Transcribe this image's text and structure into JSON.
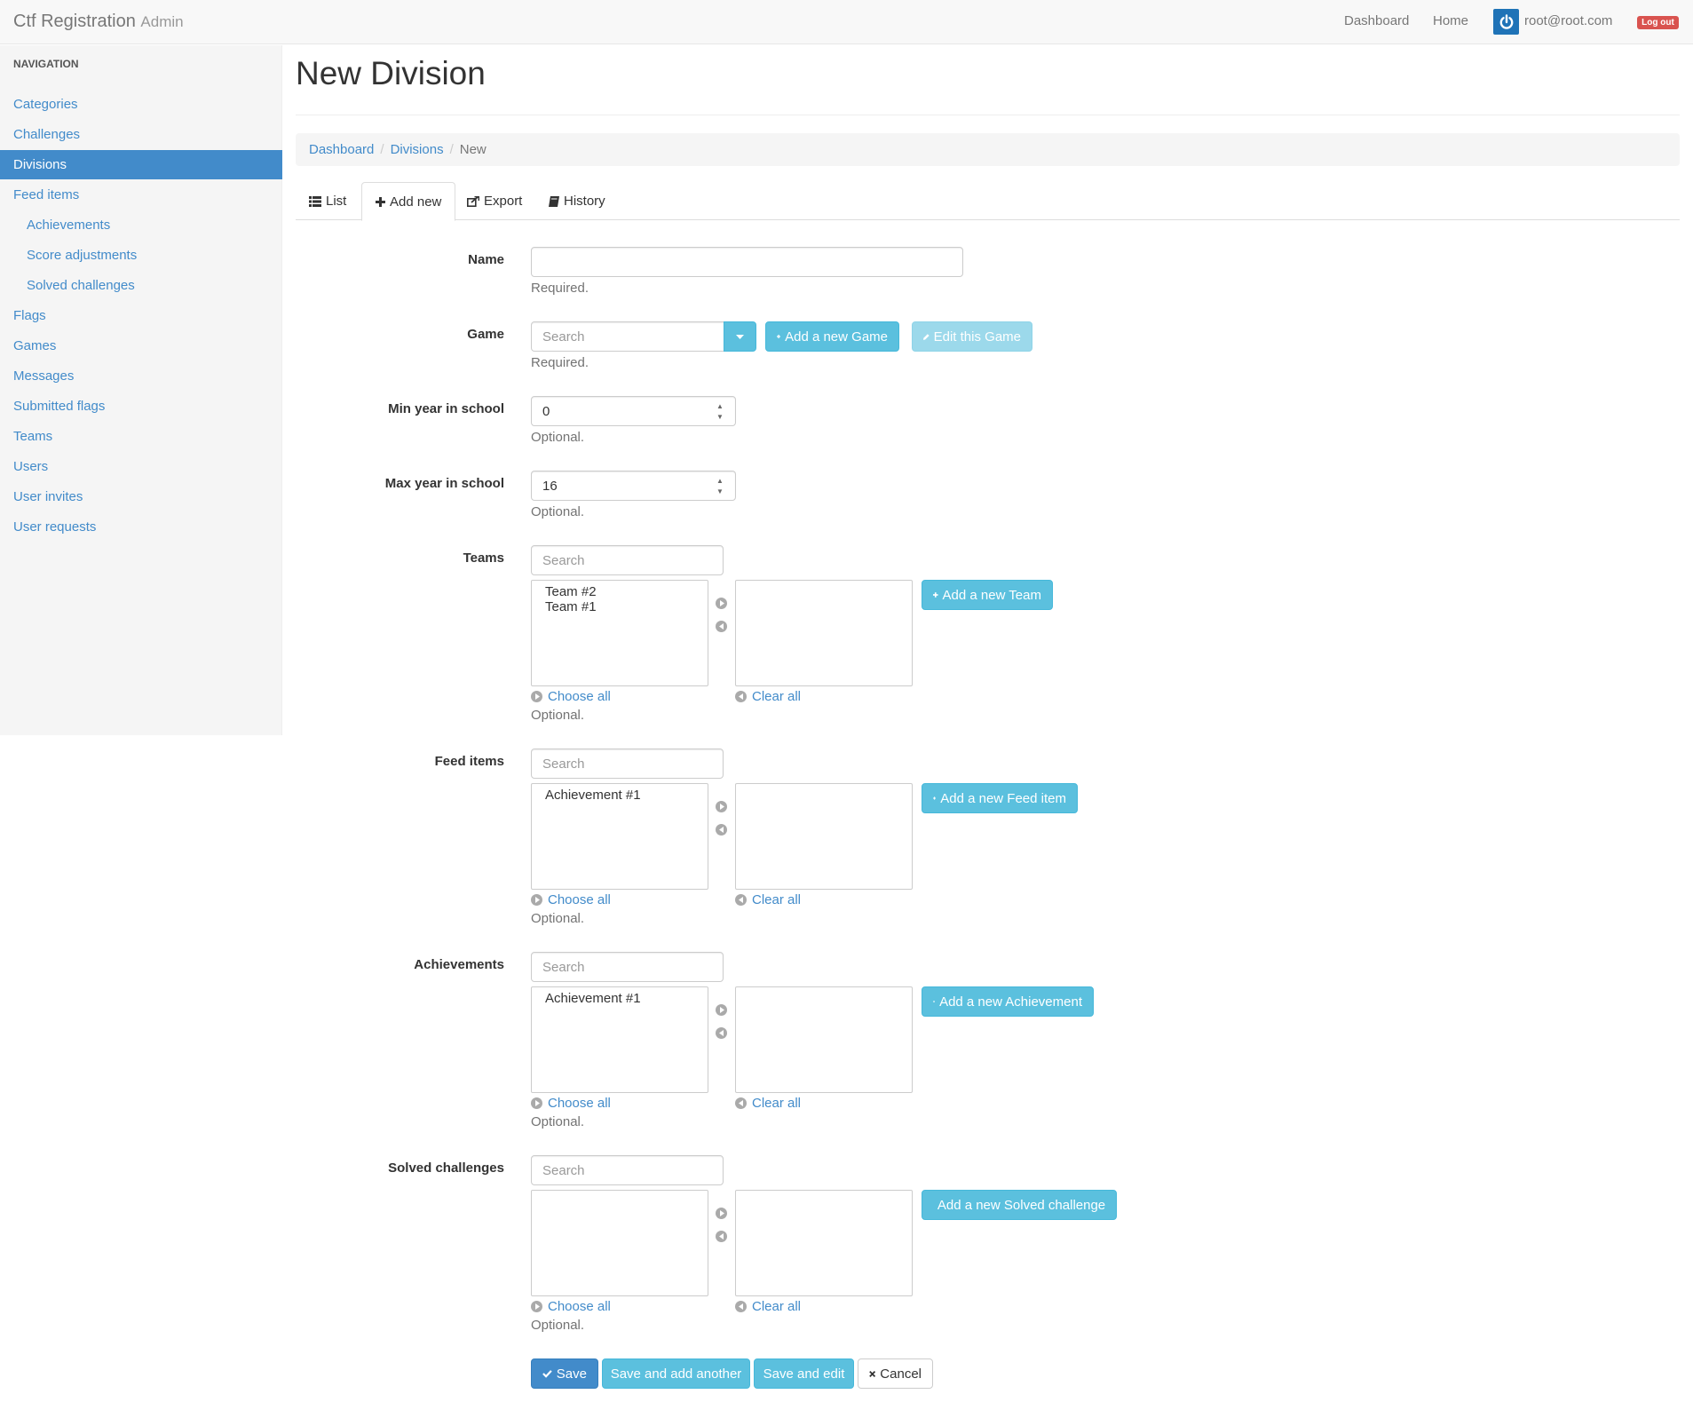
{
  "navbar": {
    "brand": "Ctf Registration",
    "brand_sub": "Admin",
    "links": [
      "Dashboard",
      "Home"
    ],
    "user_email": "root@root.com",
    "logout_label": "Log out"
  },
  "sidebar": {
    "header": "NAVIGATION",
    "items": [
      {
        "label": "Categories"
      },
      {
        "label": "Challenges"
      },
      {
        "label": "Divisions",
        "active": true
      },
      {
        "label": "Feed items"
      },
      {
        "label": "Achievements",
        "sub": true
      },
      {
        "label": "Score adjustments",
        "sub": true
      },
      {
        "label": "Solved challenges",
        "sub": true
      },
      {
        "label": "Flags"
      },
      {
        "label": "Games"
      },
      {
        "label": "Messages"
      },
      {
        "label": "Submitted flags"
      },
      {
        "label": "Teams"
      },
      {
        "label": "Users"
      },
      {
        "label": "User invites"
      },
      {
        "label": "User requests"
      }
    ]
  },
  "page": {
    "title": "New Division",
    "breadcrumb": [
      "Dashboard",
      "Divisions",
      "New"
    ],
    "tabs": [
      "List",
      "Add new",
      "Export",
      "History"
    ]
  },
  "form": {
    "name": {
      "label": "Name",
      "value": "",
      "help": "Required."
    },
    "game": {
      "label": "Game",
      "placeholder": "Search",
      "help": "Required.",
      "add_label": "Add a new Game",
      "edit_label": "Edit this Game"
    },
    "min_year": {
      "label": "Min year in school",
      "value": "0",
      "help": "Optional."
    },
    "max_year": {
      "label": "Max year in school",
      "value": "16",
      "help": "Optional."
    },
    "multi": [
      {
        "label": "Teams",
        "placeholder": "Search",
        "available": [
          "Team #2",
          "Team #1"
        ],
        "add_label": "Add a new Team",
        "choose_all": "Choose all",
        "clear_all": "Clear all",
        "help": "Optional."
      },
      {
        "label": "Feed items",
        "placeholder": "Search",
        "available": [
          "Achievement #1"
        ],
        "add_label": "Add a new Feed item",
        "choose_all": "Choose all",
        "clear_all": "Clear all",
        "help": "Optional."
      },
      {
        "label": "Achievements",
        "placeholder": "Search",
        "available": [
          "Achievement #1"
        ],
        "add_label": "Add a new Achievement",
        "choose_all": "Choose all",
        "clear_all": "Clear all",
        "help": "Optional."
      },
      {
        "label": "Solved challenges",
        "placeholder": "Search",
        "available": [],
        "add_label": "Add a new Solved challenge",
        "choose_all": "Choose all",
        "clear_all": "Clear all",
        "help": "Optional."
      }
    ],
    "actions": {
      "save": "Save",
      "save_add": "Save and add another",
      "save_edit": "Save and edit",
      "cancel": "Cancel"
    }
  },
  "colors": {
    "primary": "#428bca",
    "info": "#5bc0de",
    "danger": "#d9534f"
  }
}
